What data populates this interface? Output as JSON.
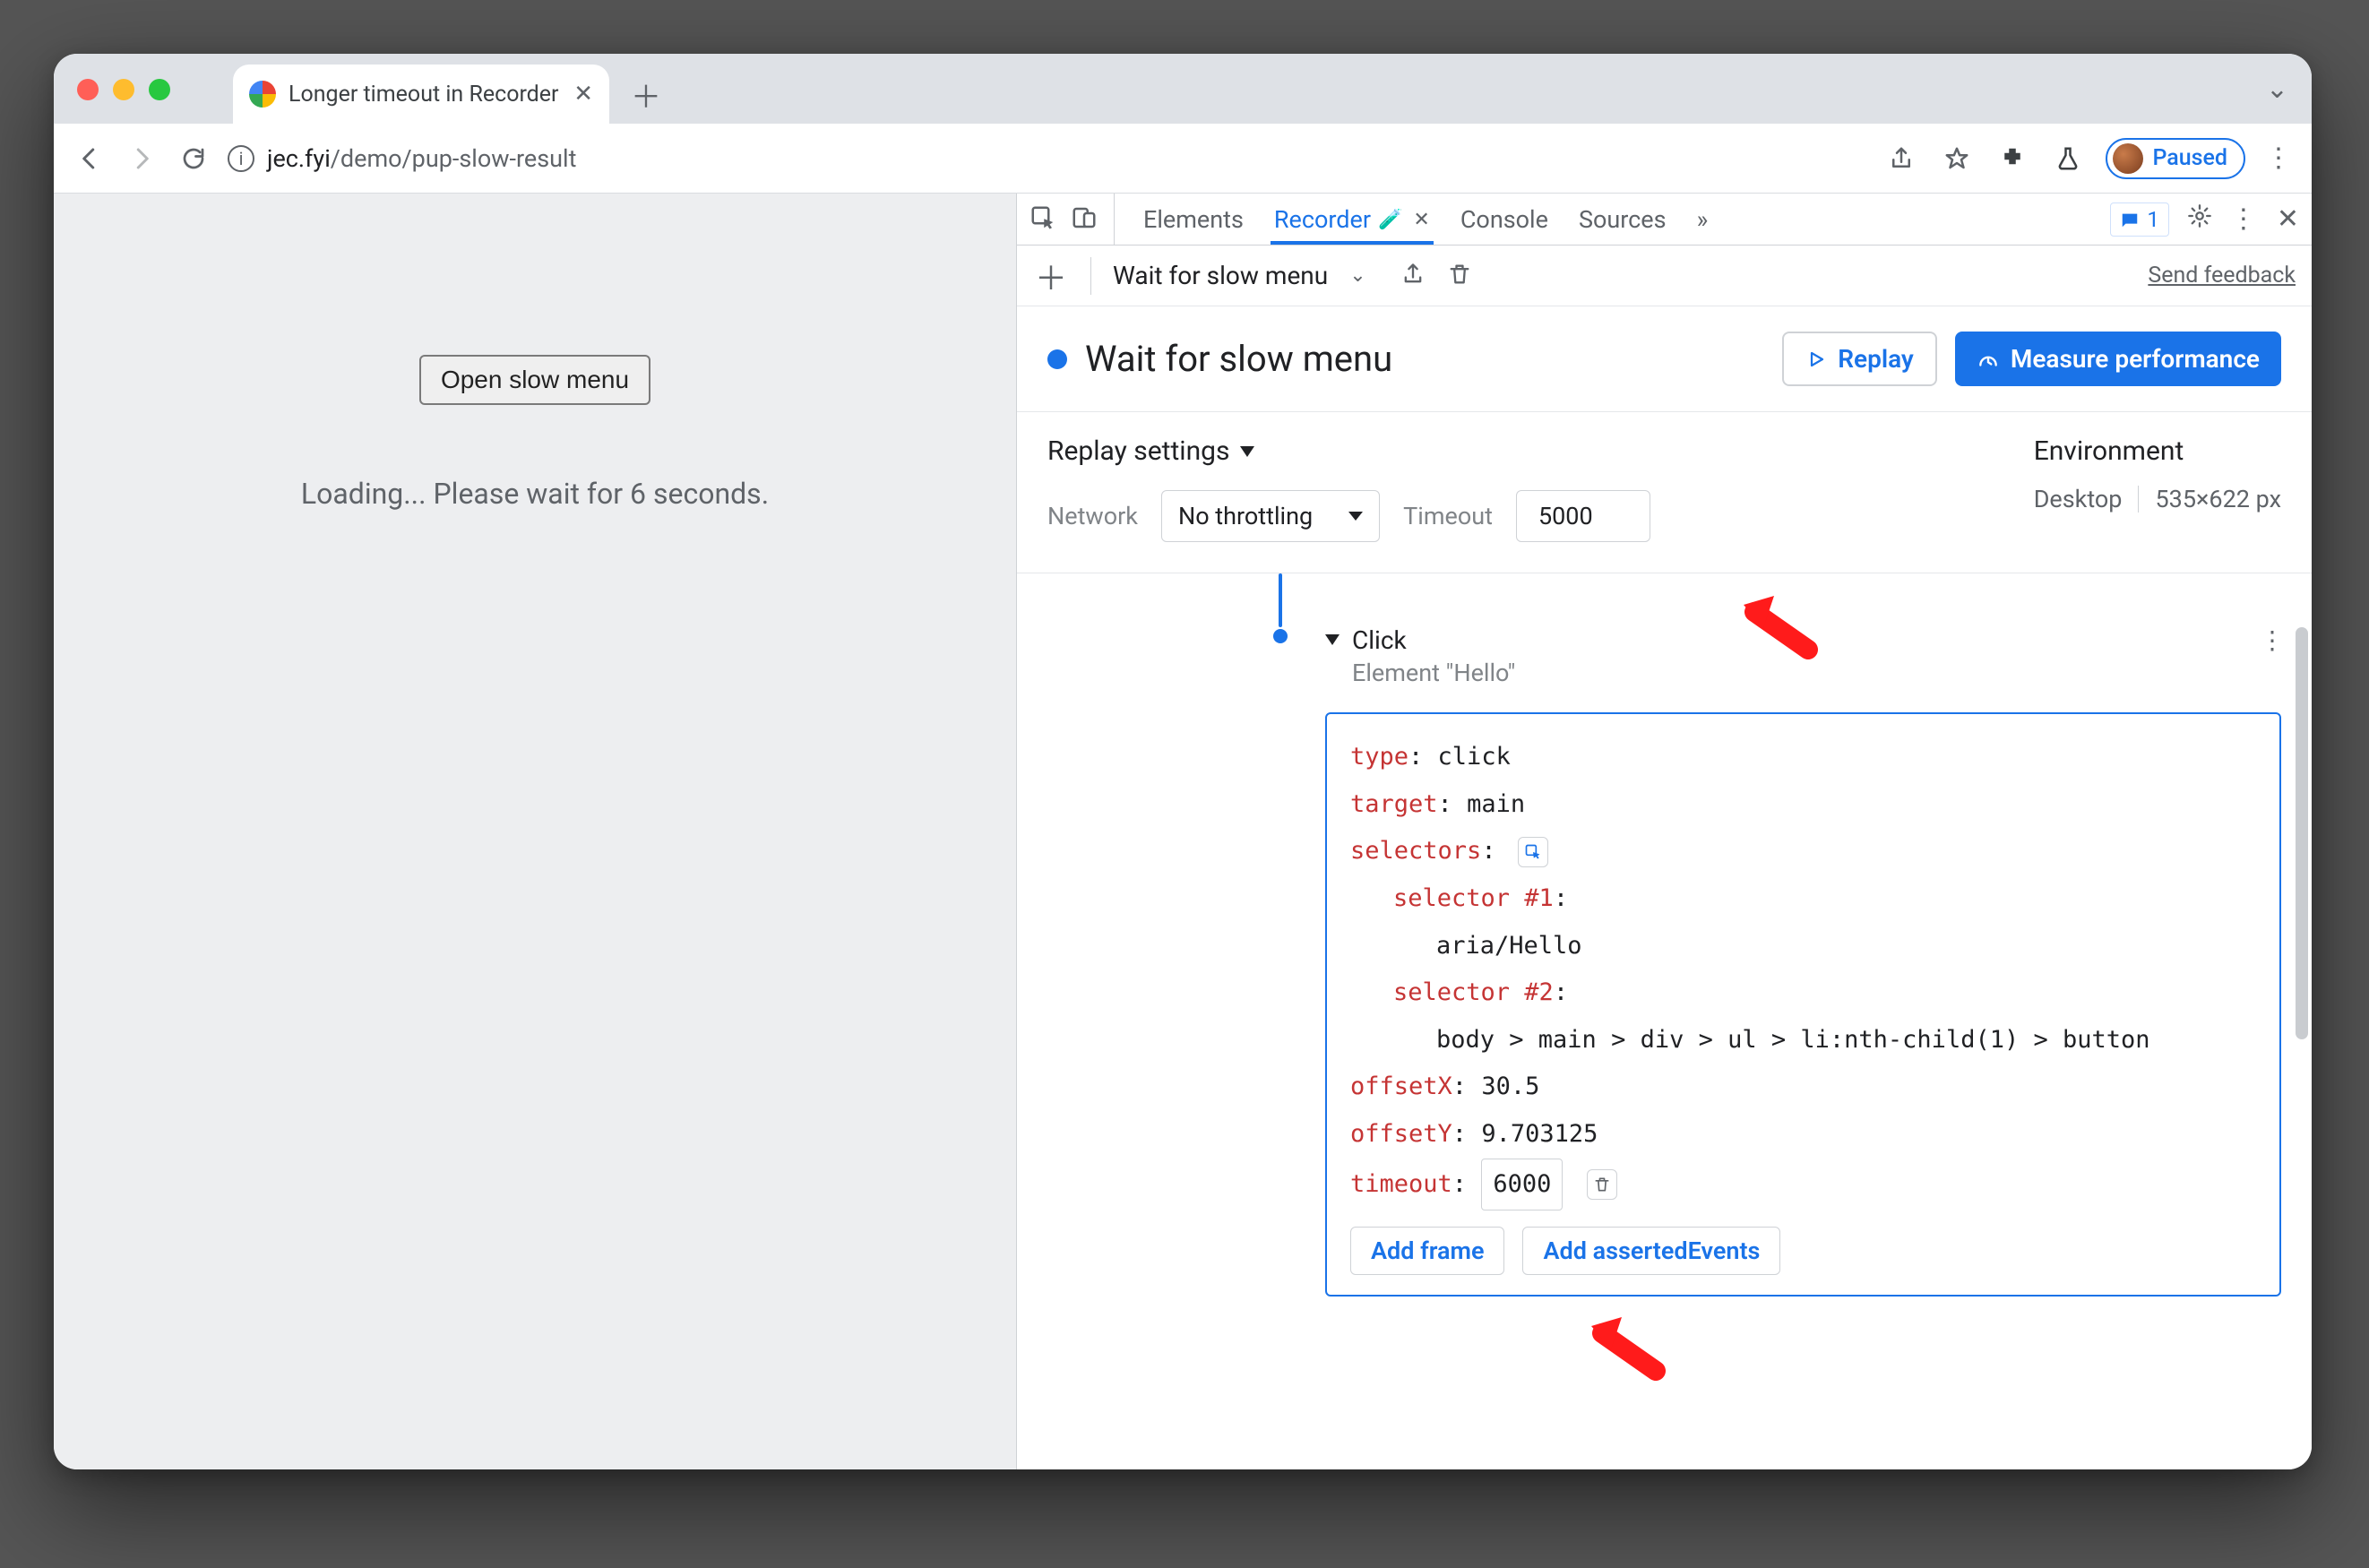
{
  "tab": {
    "title": "Longer timeout in Recorder"
  },
  "omnibox": {
    "host": "jec.fyi",
    "path": "/demo/pup-slow-result"
  },
  "paused": "Paused",
  "issue_count": "1",
  "dt_tabs": {
    "elements": "Elements",
    "recorder": "Recorder",
    "console": "Console",
    "sources": "Sources"
  },
  "recorder_bar": {
    "selected": "Wait for slow menu",
    "feedback": "Send feedback"
  },
  "recording": {
    "name": "Wait for slow menu",
    "replay": "Replay",
    "measure": "Measure performance"
  },
  "settings": {
    "title": "Replay settings",
    "network_label": "Network",
    "network_value": "No throttling",
    "timeout_label": "Timeout",
    "timeout_value": "5000"
  },
  "env": {
    "title": "Environment",
    "device": "Desktop",
    "size": "535×622 px"
  },
  "page": {
    "button": "Open slow menu",
    "loading": "Loading... Please wait for 6 seconds."
  },
  "step": {
    "title": "Click",
    "subtitle": "Element \"Hello\"",
    "type_k": "type",
    "type_v": "click",
    "target_k": "target",
    "target_v": "main",
    "selectors_k": "selectors",
    "sel1_k": "selector #1",
    "sel1_v": "aria/Hello",
    "sel2_k": "selector #2",
    "sel2_v": "body > main > div > ul > li:nth-child(1) > button",
    "offx_k": "offsetX",
    "offx_v": "30.5",
    "offy_k": "offsetY",
    "offy_v": "9.703125",
    "timeout_k": "timeout",
    "timeout_v": "6000",
    "add_frame": "Add frame",
    "add_asserted": "Add assertedEvents"
  }
}
